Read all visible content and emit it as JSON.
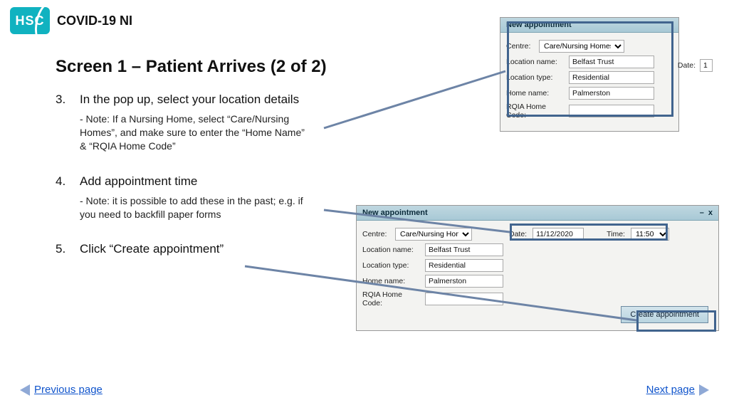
{
  "header": {
    "logo_text": "HSC",
    "app_title": "COVID-19 NI"
  },
  "headline": "Screen 1 – Patient Arrives (2 of 2)",
  "steps": [
    {
      "num": "3.",
      "text": "In the pop up, select your location details",
      "note": "- Note: If a Nursing Home, select “Care/Nursing Homes”, and make sure to enter the “Home Name” & “RQIA Home Code”"
    },
    {
      "num": "4.",
      "text": "Add appointment time",
      "note": "- Note: it is possible to add these in the past; e.g. if you need to backfill paper forms"
    },
    {
      "num": "5.",
      "text": "Click “Create appointment”",
      "note": ""
    }
  ],
  "mock1": {
    "title": "New appointment",
    "centre_label": "Centre:",
    "centre_value": "Care/Nursing Homes",
    "date_label": "Date:",
    "date_value": "1",
    "locname_label": "Location name:",
    "locname_value": "Belfast Trust",
    "loctype_label": "Location type:",
    "loctype_value": "Residential",
    "homename_label": "Home name:",
    "homename_value": "Palmerston",
    "rqia_label": "RQIA Home Code:",
    "rqia_value": ""
  },
  "mock2": {
    "title": "New appointment",
    "centre_label": "Centre:",
    "centre_value": "Care/Nursing Homes",
    "date_label": "Date:",
    "date_value": "11/12/2020",
    "time_label": "Time:",
    "time_value": "11:50",
    "locname_label": "Location name:",
    "locname_value": "Belfast Trust",
    "loctype_label": "Location type:",
    "loctype_value": "Residential",
    "homename_label": "Home name:",
    "homename_value": "Palmerston",
    "rqia_label": "RQIA Home Code:",
    "rqia_value": "",
    "create_btn": "Create appointment",
    "win_minimize": "–",
    "win_close": "x"
  },
  "nav": {
    "prev": "Previous page",
    "next": "Next page"
  }
}
